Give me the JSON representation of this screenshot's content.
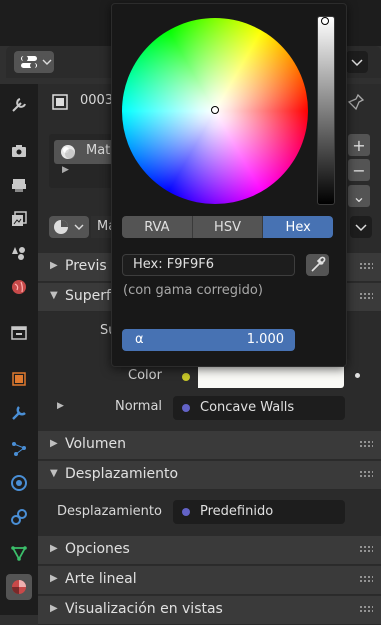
{
  "header": {
    "object_name": "0003",
    "material_slot": "Mate",
    "material_name": "Ma"
  },
  "slot_buttons": {
    "add": "+",
    "remove": "−",
    "more": "⌄"
  },
  "panels": {
    "preview": "Previs",
    "surface": "Superf",
    "surface_label": "Su",
    "volume": "Volumen",
    "displacement": "Desplazamiento",
    "options": "Opciones",
    "lineart": "Arte lineal",
    "viewport_display": "Visualización en vistas"
  },
  "props": {
    "color_label": "Color",
    "color_value": "#F9F9F6",
    "normal_label": "Normal",
    "normal_value": "Concave Walls",
    "displacement_label": "Desplazamiento",
    "displacement_value": "Predefinido"
  },
  "picker": {
    "modes": [
      "RVA",
      "HSV",
      "Hex"
    ],
    "active_mode": "Hex",
    "hex_field": "Hex: F9F9F6",
    "hex_note": "(con gama corregido)",
    "alpha_label": "α",
    "alpha_value": "1.000"
  },
  "colors": {
    "accent": "#4772b3",
    "socket_yellow": "#c7c729",
    "socket_purple": "#6363c7",
    "panel_bg": "#2b2b2b",
    "active_tab": "#c94949"
  },
  "sidebar_icons": [
    "tool-icon",
    "render-icon",
    "output-icon",
    "view-layer-icon",
    "scene-icon",
    "world-icon",
    "collection-icon",
    "object-icon",
    "modifier-icon",
    "particles-icon",
    "physics-icon",
    "constraints-icon",
    "data-icon",
    "material-icon"
  ]
}
